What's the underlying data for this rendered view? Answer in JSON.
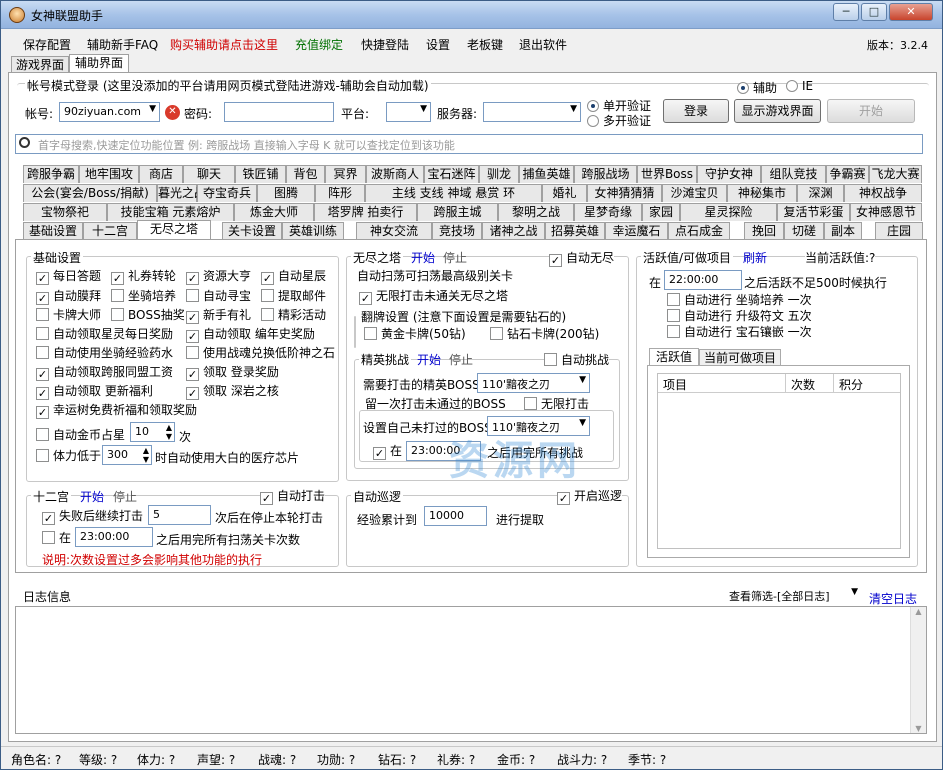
{
  "window": {
    "title": "女神联盟助手",
    "version": "版本：3.2.4",
    "buttons": {
      "min": "─",
      "max": "□",
      "close": "✕"
    }
  },
  "menu": [
    "保存配置",
    "辅助新手FAQ",
    "购买辅助请点击这里",
    "充值绑定",
    "快捷登陆",
    "设置",
    "老板键",
    "退出软件"
  ],
  "top_tabs": [
    "游戏界面",
    "辅助界面"
  ],
  "login": {
    "title": "帐号模式登录 (这里没添加的平台请用网页模式登陆进游戏-辅助会自动加载)",
    "mode_assist": "辅助",
    "mode_ie": "IE",
    "account_label": "帐号:",
    "account_value": "90ziyuan.com",
    "password_label": "密码:",
    "platform_label": "平台:",
    "server_label": "服务器:",
    "single_verify": "单开验证",
    "multi_verify": "多开验证",
    "login_button": "登录",
    "show_game_button": "显示游戏界面",
    "start_button": "开始"
  },
  "search": {
    "placeholder": "首字母搜索,快速定位功能位置     例: 跨服战场  直接输入字母  K  就可以查找定位到该功能"
  },
  "feature_tabs": {
    "row1": [
      "跨服争霸",
      "地牢围攻",
      "商店",
      "聊天",
      "铁匠铺",
      "背包",
      "冥界",
      "波斯商人",
      "宝石迷阵",
      "驯龙",
      "捕鱼英雄",
      "跨服战场",
      "世界Boss",
      "守护女神",
      "组队竞技",
      "争霸赛",
      "飞龙大赛"
    ],
    "row2": [
      "公会(宴会/Boss/捐献)",
      "暮光之战",
      "夺宝奇兵",
      "图腾",
      "阵形",
      "主线 支线 神域 悬赏 环",
      "婚礼",
      "女神猜猜猜",
      "沙滩宝贝",
      "神秘集市",
      "深渊",
      "神权战争"
    ],
    "row3": [
      "宝物祭祀",
      "技能宝箱 元素熔炉",
      "炼金大师",
      "塔罗牌 拍卖行",
      "跨服主城",
      "黎明之战",
      "星梦奇缘",
      "家园",
      "星灵探险",
      "复活节彩蛋",
      "女神感恩节"
    ],
    "row4": [
      "基础设置",
      "十二宫",
      "无尽之塔",
      "关卡设置",
      "英雄训练",
      "神女交流",
      "竞技场",
      "诸神之战",
      "招募英雄",
      "幸运魔石",
      "点石成金",
      "挽回",
      "切磋",
      "副本",
      "庄园"
    ]
  },
  "basic": {
    "title": "基础设置",
    "items": [
      {
        "label": "每日答题",
        "checked": true
      },
      {
        "label": "礼券转轮",
        "checked": true
      },
      {
        "label": "资源大亨",
        "checked": true
      },
      {
        "label": "自动星辰",
        "checked": true
      },
      {
        "label": "自动膜拜",
        "checked": true
      },
      {
        "label": "坐骑培养",
        "checked": false
      },
      {
        "label": "自动寻宝",
        "checked": false
      },
      {
        "label": "提取邮件",
        "checked": false
      },
      {
        "label": "卡牌大师",
        "checked": false
      },
      {
        "label": "BOSS抽奖",
        "checked": false
      },
      {
        "label": "新手有礼",
        "checked": true
      },
      {
        "label": "精彩活动",
        "checked": false
      },
      {
        "label": "自动领取星灵每日奖励",
        "checked": false
      },
      {
        "label": "自动领取  编年史奖励",
        "checked": true
      },
      {
        "label": "自动使用坐骑经验药水",
        "checked": false
      },
      {
        "label": "使用战魂兑换低阶神之石",
        "checked": false
      },
      {
        "label": "自动领取跨服同盟工资",
        "checked": true
      },
      {
        "label": "领取  登录奖励",
        "checked": true
      },
      {
        "label": "自动领取  更新福利",
        "checked": true
      },
      {
        "label": "领取  深岩之核",
        "checked": true
      },
      {
        "label": "幸运树免费祈福和领取奖励",
        "checked": true
      }
    ],
    "gold_label": "自动金币占星",
    "gold_value": "10",
    "gold_unit": "次",
    "stamina_label": "体力低于",
    "stamina_value": "300",
    "stamina_suffix": "时自动使用大白的医疗芯片"
  },
  "zodiac": {
    "title": "十二宫",
    "start": "开始",
    "stop": "停止",
    "auto_attack": "自动打击",
    "continue_label": "失败后继续打击",
    "continue_value": "5",
    "continue_suffix": "次后在停止本轮打击",
    "at_label": "在",
    "at_time": "23:00:00",
    "at_suffix": "之后用完所有扫荡关卡次数",
    "note": "说明:次数设置过多会影响其他功能的执行"
  },
  "tower": {
    "title": "无尽之塔",
    "start": "开始",
    "stop": "停止",
    "auto_endless": "自动无尽",
    "sweep_note": "自动扫荡可扫荡最高级别关卡",
    "unlimited": "无限打击未通关无尽之塔",
    "flip_title": "翻牌设置 (注意下面设置是需要钻石的)",
    "gold_card": "黄金卡牌(50钻)",
    "diamond_card": "钻石卡牌(200钻)"
  },
  "elite": {
    "title": "精英挑战",
    "start": "开始",
    "stop": "停止",
    "auto_challenge": "自动挑战",
    "boss_label": "需要打击的精英BOSS",
    "boss_value": "110'黯夜之刃",
    "leave_label": "留一次打击未通过的BOSS",
    "unlimited": "无限打击",
    "set_label": "设置自己未打过的BOSS",
    "set_value": "110'黯夜之刃",
    "at_label": "在",
    "at_time": "23:00:00",
    "at_suffix": "之后用完所有挑战"
  },
  "patrol": {
    "title": "自动巡逻",
    "enable": "开启巡逻",
    "exp_label": "经验累计到",
    "exp_value": "10000",
    "exp_suffix": "进行提取"
  },
  "activity": {
    "title": "活跃值/可做项目",
    "refresh": "刷新",
    "current": "当前活跃值:?",
    "at_label": "在",
    "at_time": "22:00:00",
    "at_suffix": "之后活跃不足500时候执行",
    "tasks": [
      {
        "label": "自动进行  坐骑培养  一次",
        "checked": false
      },
      {
        "label": "自动进行  升级符文  五次",
        "checked": false
      },
      {
        "label": "自动进行  宝石镶嵌  一次",
        "checked": false
      }
    ],
    "tabs": [
      "活跃值",
      "当前可做项目"
    ],
    "columns": [
      "项目",
      "次数",
      "积分"
    ]
  },
  "log": {
    "title": "日志信息",
    "filter": "查看筛选-[全部日志]",
    "clear": "清空日志"
  },
  "status": [
    "角色名: ?",
    "等级: ?",
    "体力: ?",
    "声望: ?",
    "战魂: ?",
    "功勋: ?",
    "钻石: ?",
    "礼券: ?",
    "金币: ?",
    "战斗力: ?",
    "季节: ?"
  ],
  "watermark": "资源网"
}
